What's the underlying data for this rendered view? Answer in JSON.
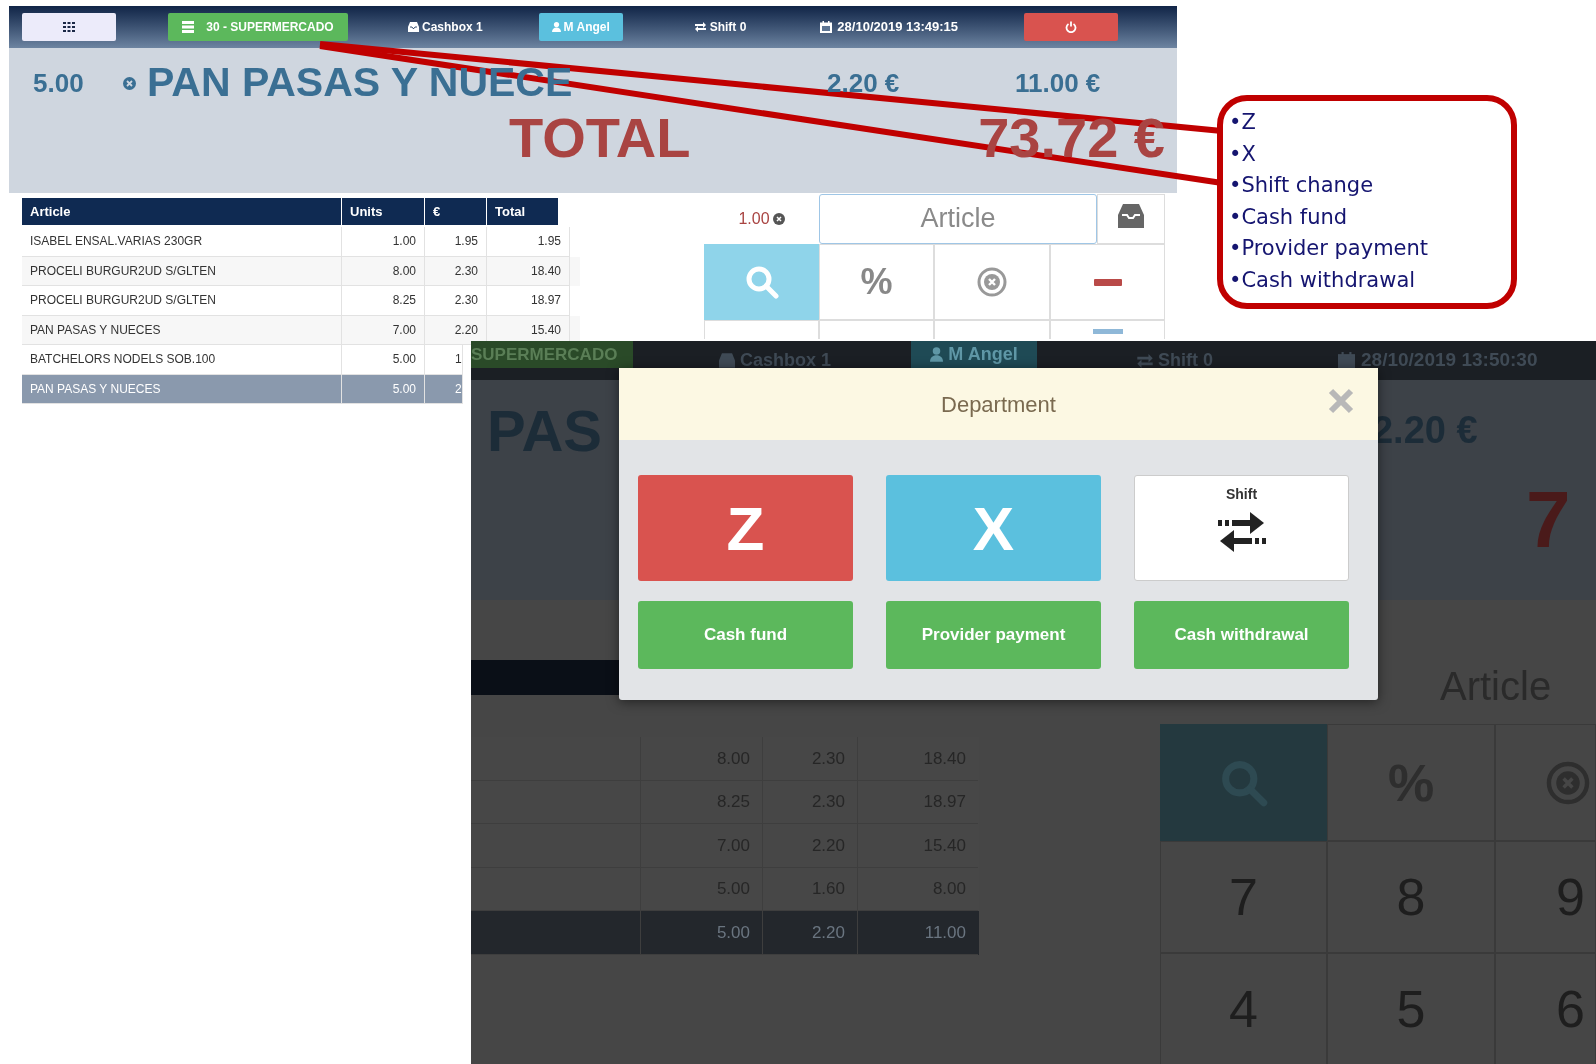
{
  "screenshot_1": {
    "top_bar": {
      "department": "30 - SUPERMERCADO",
      "cashbox": "Cashbox 1",
      "user": "M Angel",
      "shift": "Shift 0",
      "datetime": "28/10/2019 13:49:15"
    },
    "current_item": {
      "units": "5.00",
      "name": "PAN PASAS Y NUECE",
      "price": "2.20 €",
      "total": "11.00 €"
    },
    "total": {
      "label": "TOTAL",
      "value": "73.72 €"
    },
    "table": {
      "columns": [
        "Article",
        "Units",
        "€",
        "Total"
      ],
      "rows": [
        {
          "cells": [
            "ISABEL ENSAL.VARIAS 230GR",
            "1.00",
            "1.95",
            "1.95"
          ],
          "selected": false
        },
        {
          "cells": [
            "PROCELI BURGUR2UD S/GLTEN",
            "8.00",
            "2.30",
            "18.40"
          ],
          "selected": false
        },
        {
          "cells": [
            "PROCELI BURGUR2UD S/GLTEN",
            "8.25",
            "2.30",
            "18.97"
          ],
          "selected": false
        },
        {
          "cells": [
            "PAN PASAS Y NUECES",
            "7.00",
            "2.20",
            "15.40"
          ],
          "selected": false
        },
        {
          "cells": [
            "BATCHELORS NODELS SOB.100",
            "5.00",
            "1"
          ],
          "selected": false
        },
        {
          "cells": [
            "PAN PASAS Y NUECES",
            "5.00",
            "2"
          ],
          "selected": true
        }
      ]
    },
    "quantity": "1.00",
    "article_field": {
      "placeholder": "Article"
    },
    "percent_key": "%"
  },
  "screenshot_2": {
    "top_bar": {
      "department": "SUPERMERCADO",
      "cashbox": "Cashbox 1",
      "user": "M Angel",
      "shift": "Shift 0",
      "datetime": "28/10/2019 13:50:30"
    },
    "current_item": {
      "name": "PAS",
      "price": "2.20 €"
    },
    "total_value": "7",
    "table_rows": [
      {
        "cells": [
          "8.00",
          "2.30",
          "18.40"
        ],
        "selected": false
      },
      {
        "cells": [
          "8.25",
          "2.30",
          "18.97"
        ],
        "selected": false
      },
      {
        "cells": [
          "7.00",
          "2.20",
          "15.40"
        ],
        "selected": false
      },
      {
        "cells": [
          "5.00",
          "1.60",
          "8.00"
        ],
        "selected": false
      },
      {
        "cells": [
          "5.00",
          "2.20",
          "11.00"
        ],
        "selected": true
      }
    ],
    "article_field": {
      "placeholder": "Article"
    },
    "percent_key": "%",
    "keypad": [
      "7",
      "8",
      "9",
      "4",
      "5",
      "6"
    ],
    "dialog": {
      "title": "Department",
      "buttons": [
        {
          "label": "Z",
          "kind": "letter",
          "color": "#d9534f"
        },
        {
          "label": "X",
          "kind": "letter",
          "color": "#5bc0de"
        },
        {
          "label": "Shift",
          "kind": "icon",
          "color": "#ffffff"
        },
        {
          "label": "Cash fund",
          "kind": "action",
          "color": "#5cb85c"
        },
        {
          "label": "Provider payment",
          "kind": "action",
          "color": "#5cb85c"
        },
        {
          "label": "Cash withdrawal",
          "kind": "action",
          "color": "#5cb85c"
        }
      ]
    }
  },
  "callout": {
    "items": [
      "•Z",
      "•X",
      "•Shift change",
      "•Cash fund",
      "•Provider payment",
      "•Cash withdrawal"
    ]
  }
}
